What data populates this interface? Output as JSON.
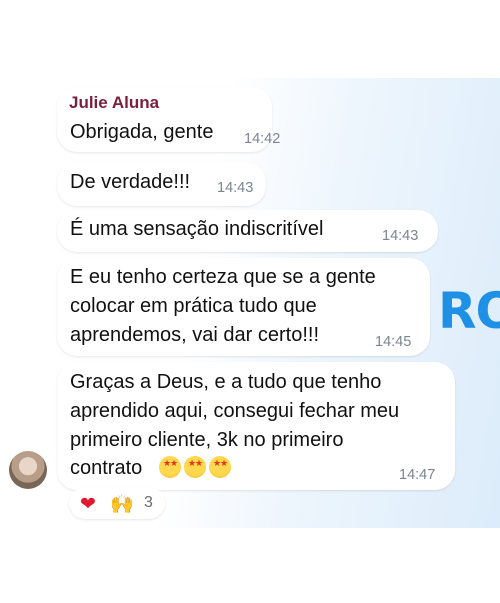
{
  "sender": "Julie Aluna",
  "messages": [
    {
      "text": "Obrigada, gente",
      "time": "14:42"
    },
    {
      "text": "De verdade!!!",
      "time": "14:43"
    },
    {
      "text": "É uma sensação indiscritível",
      "time": "14:43"
    },
    {
      "lines": [
        "E eu tenho certeza que se a gente",
        "colocar em prática tudo que",
        "aprendemos, vai dar certo!!!"
      ],
      "time": "14:45"
    },
    {
      "lines": [
        "Graças a Deus, e a tudo que tenho",
        "aprendido aqui, consegui fechar meu",
        "primeiro cliente, 3k no primeiro",
        "contrato"
      ],
      "emoji": "star-struck-face",
      "emoji_count": 3,
      "time": "14:47"
    }
  ],
  "reactions": {
    "heart": "❤",
    "hands": "🙌",
    "count": "3"
  },
  "watermark": "RO",
  "colors": {
    "sender": "#7a1f3d",
    "watermark": "#1e90e6",
    "heart": "#e0192f"
  }
}
